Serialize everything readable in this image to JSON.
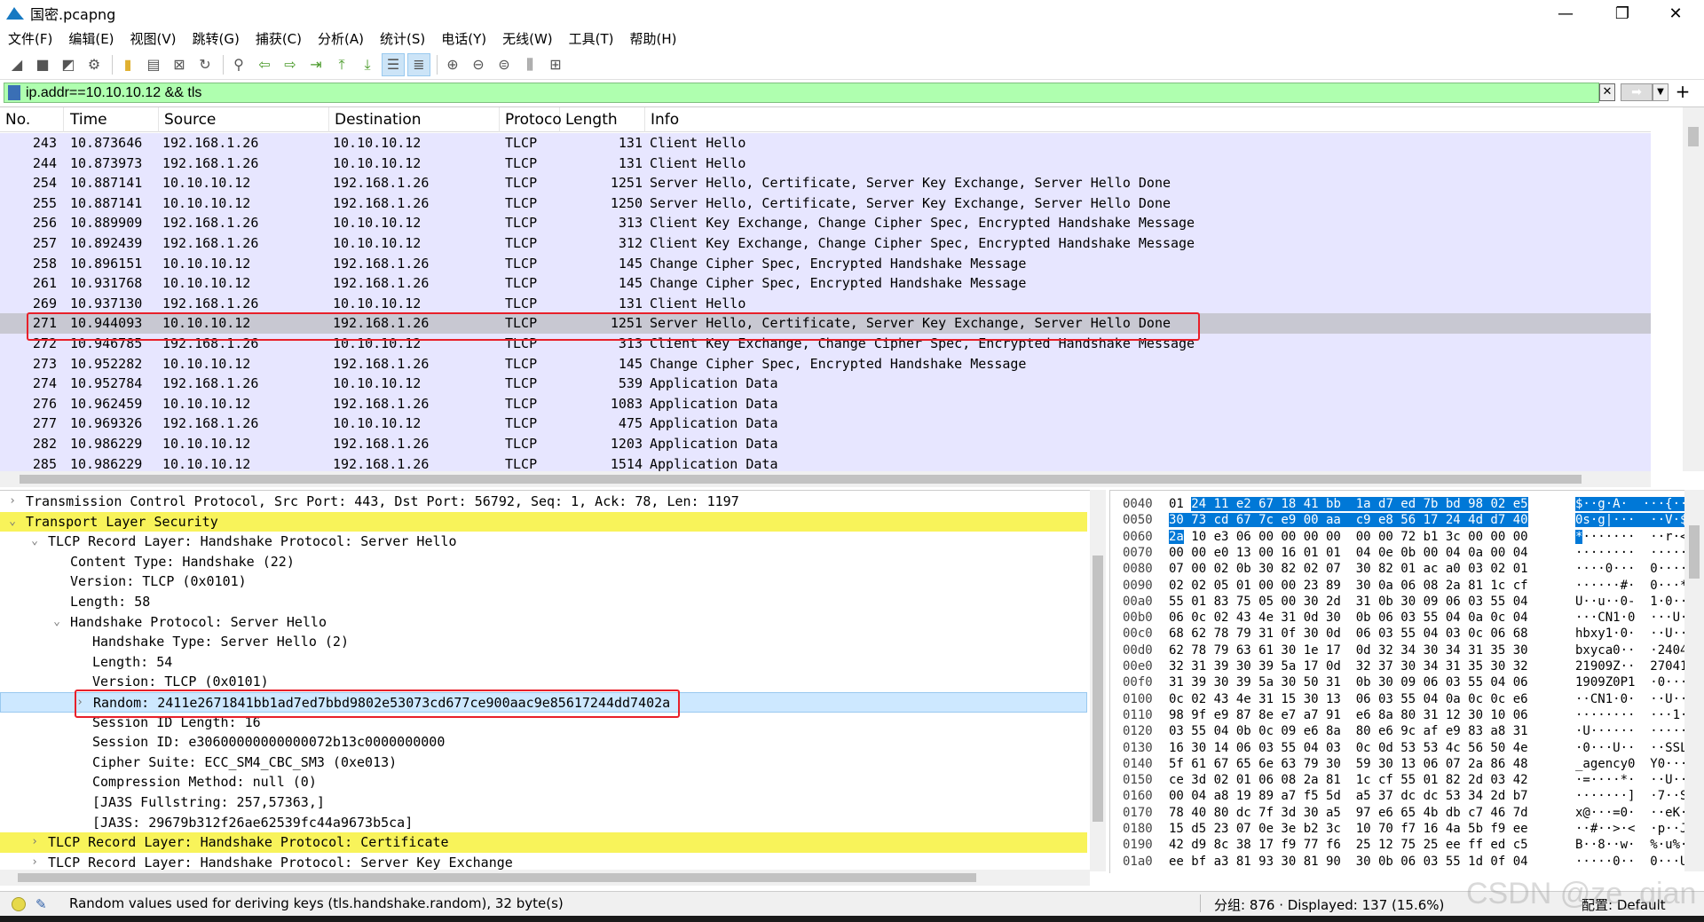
{
  "window": {
    "title": "国密.pcapng",
    "minimize": "—",
    "maximize": "❐",
    "close": "✕"
  },
  "menu": [
    "文件(F)",
    "编辑(E)",
    "视图(V)",
    "跳转(G)",
    "捕获(C)",
    "分析(A)",
    "统计(S)",
    "电话(Y)",
    "无线(W)",
    "工具(T)",
    "帮助(H)"
  ],
  "toolbar_icons": [
    "shark-fin-start-icon",
    "stop-icon",
    "restart-icon",
    "options-icon",
    "open-icon",
    "save-icon",
    "close-file-icon",
    "reload-icon",
    "find-icon",
    "go-back-icon",
    "go-forward-icon",
    "go-to-packet-icon",
    "first-packet-icon",
    "last-packet-icon",
    "autoscroll-icon",
    "colorize-icon",
    "zoom-in-icon",
    "zoom-out-icon",
    "normal-size-icon",
    "resize-columns-icon",
    "layout-icon"
  ],
  "filter": {
    "value": "ip.addr==10.10.10.12 && tls",
    "apply_glyph": "➡"
  },
  "columns": [
    "No.",
    "Time",
    "Source",
    "Destination",
    "Protoco",
    "Length",
    "Info"
  ],
  "packets": [
    {
      "no": "243",
      "time": "10.873646",
      "src": "192.168.1.26",
      "dst": "10.10.10.12",
      "proto": "TLCP",
      "len": "131",
      "info": "Client Hello"
    },
    {
      "no": "244",
      "time": "10.873973",
      "src": "192.168.1.26",
      "dst": "10.10.10.12",
      "proto": "TLCP",
      "len": "131",
      "info": "Client Hello"
    },
    {
      "no": "254",
      "time": "10.887141",
      "src": "10.10.10.12",
      "dst": "192.168.1.26",
      "proto": "TLCP",
      "len": "1251",
      "info": "Server Hello, Certificate, Server Key Exchange, Server Hello Done"
    },
    {
      "no": "255",
      "time": "10.887141",
      "src": "10.10.10.12",
      "dst": "192.168.1.26",
      "proto": "TLCP",
      "len": "1250",
      "info": "Server Hello, Certificate, Server Key Exchange, Server Hello Done"
    },
    {
      "no": "256",
      "time": "10.889909",
      "src": "192.168.1.26",
      "dst": "10.10.10.12",
      "proto": "TLCP",
      "len": "313",
      "info": "Client Key Exchange, Change Cipher Spec, Encrypted Handshake Message"
    },
    {
      "no": "257",
      "time": "10.892439",
      "src": "192.168.1.26",
      "dst": "10.10.10.12",
      "proto": "TLCP",
      "len": "312",
      "info": "Client Key Exchange, Change Cipher Spec, Encrypted Handshake Message"
    },
    {
      "no": "258",
      "time": "10.896151",
      "src": "10.10.10.12",
      "dst": "192.168.1.26",
      "proto": "TLCP",
      "len": "145",
      "info": "Change Cipher Spec, Encrypted Handshake Message"
    },
    {
      "no": "261",
      "time": "10.931768",
      "src": "10.10.10.12",
      "dst": "192.168.1.26",
      "proto": "TLCP",
      "len": "145",
      "info": "Change Cipher Spec, Encrypted Handshake Message"
    },
    {
      "no": "269",
      "time": "10.937130",
      "src": "192.168.1.26",
      "dst": "10.10.10.12",
      "proto": "TLCP",
      "len": "131",
      "info": "Client Hello"
    },
    {
      "no": "271",
      "time": "10.944093",
      "src": "10.10.10.12",
      "dst": "192.168.1.26",
      "proto": "TLCP",
      "len": "1251",
      "info": "Server Hello, Certificate, Server Key Exchange, Server Hello Done",
      "selected": true
    },
    {
      "no": "272",
      "time": "10.946785",
      "src": "192.168.1.26",
      "dst": "10.10.10.12",
      "proto": "TLCP",
      "len": "313",
      "info": "Client Key Exchange, Change Cipher Spec, Encrypted Handshake Message"
    },
    {
      "no": "273",
      "time": "10.952282",
      "src": "10.10.10.12",
      "dst": "192.168.1.26",
      "proto": "TLCP",
      "len": "145",
      "info": "Change Cipher Spec, Encrypted Handshake Message"
    },
    {
      "no": "274",
      "time": "10.952784",
      "src": "192.168.1.26",
      "dst": "10.10.10.12",
      "proto": "TLCP",
      "len": "539",
      "info": "Application Data"
    },
    {
      "no": "276",
      "time": "10.962459",
      "src": "10.10.10.12",
      "dst": "192.168.1.26",
      "proto": "TLCP",
      "len": "1083",
      "info": "Application Data"
    },
    {
      "no": "277",
      "time": "10.969326",
      "src": "192.168.1.26",
      "dst": "10.10.10.12",
      "proto": "TLCP",
      "len": "475",
      "info": "Application Data"
    },
    {
      "no": "282",
      "time": "10.986229",
      "src": "10.10.10.12",
      "dst": "192.168.1.26",
      "proto": "TLCP",
      "len": "1203",
      "info": "Application Data"
    },
    {
      "no": "285",
      "time": "10.986229",
      "src": "10.10.10.12",
      "dst": "192.168.1.26",
      "proto": "TLCP",
      "len": "1514",
      "info": "Application Data"
    }
  ],
  "details": [
    {
      "arrow": "›",
      "level": 0,
      "text": "Transmission Control Protocol, Src Port: 443, Dst Port: 56792, Seq: 1, Ack: 78, Len: 1197"
    },
    {
      "arrow": "⌄",
      "level": 0,
      "text": "Transport Layer Security",
      "highlight": true
    },
    {
      "arrow": "⌄",
      "level": 1,
      "text": "TLCP Record Layer: Handshake Protocol: Server Hello"
    },
    {
      "arrow": "",
      "level": 2,
      "text": "Content Type: Handshake (22)"
    },
    {
      "arrow": "",
      "level": 2,
      "text": "Version: TLCP (0x0101)"
    },
    {
      "arrow": "",
      "level": 2,
      "text": "Length: 58"
    },
    {
      "arrow": "⌄",
      "level": 2,
      "text": "Handshake Protocol: Server Hello"
    },
    {
      "arrow": "",
      "level": 3,
      "text": "Handshake Type: Server Hello (2)"
    },
    {
      "arrow": "",
      "level": 3,
      "text": "Length: 54"
    },
    {
      "arrow": "",
      "level": 3,
      "text": "Version: TLCP (0x0101)"
    },
    {
      "arrow": "›",
      "level": 3,
      "text": "Random: 2411e2671841bb1ad7ed7bbd9802e53073cd677ce900aac9e85617244dd7402a",
      "selected": true
    },
    {
      "arrow": "",
      "level": 3,
      "text": "Session ID Length: 16"
    },
    {
      "arrow": "",
      "level": 3,
      "text": "Session ID: e30600000000000072b13c0000000000"
    },
    {
      "arrow": "",
      "level": 3,
      "text": "Cipher Suite: ECC_SM4_CBC_SM3 (0xe013)"
    },
    {
      "arrow": "",
      "level": 3,
      "text": "Compression Method: null (0)"
    },
    {
      "arrow": "",
      "level": 3,
      "text": "[JA3S Fullstring: 257,57363,]"
    },
    {
      "arrow": "",
      "level": 3,
      "text": "[JA3S: 29679b312f26ae62539fc44a9673b5ca]"
    },
    {
      "arrow": "›",
      "level": 1,
      "text": "TLCP Record Layer: Handshake Protocol: Certificate",
      "highlight": true
    },
    {
      "arrow": "›",
      "level": 1,
      "text": "TLCP Record Layer: Handshake Protocol: Server Key Exchange"
    }
  ],
  "hex": [
    {
      "off": "0040",
      "pre": "01 ",
      "sel": "24 11 e2 67 18 41 bb  1a d7 ed 7b bd 98 02 e5",
      "post": "",
      "apre": "",
      "asel": "$··g·A·  ···{····",
      "apost": ""
    },
    {
      "off": "0050",
      "pre": "",
      "sel": "30 73 cd 67 7c e9 00 aa  c9 e8 56 17 24 4d d7 40",
      "post": "",
      "apre": "",
      "asel": "0s·g|···  ··V·$M·@",
      "apost": ""
    },
    {
      "off": "0060",
      "pre": "",
      "sel": "2a",
      "post": " 10 e3 06 00 00 00 00  00 00 72 b1 3c 00 00 00",
      "apre": "",
      "asel": "*",
      "apost": "·······  ··r·<···"
    },
    {
      "off": "0070",
      "pre": "00 00 e0 13 00 16 01 01  04 0e 0b 00 04 0a 00 04",
      "sel": "",
      "post": "",
      "apre": "········  ········",
      "asel": "",
      "apost": ""
    },
    {
      "off": "0080",
      "pre": "07 00 02 0b 30 82 02 07  30 82 01 ac a0 03 02 01",
      "sel": "",
      "post": "",
      "apre": "····0···  0·······",
      "asel": "",
      "apost": ""
    },
    {
      "off": "0090",
      "pre": "02 02 05 01 00 00 23 89  30 0a 06 08 2a 81 1c cf",
      "sel": "",
      "post": "",
      "apre": "······#·  0···*···",
      "asel": "",
      "apost": ""
    },
    {
      "off": "00a0",
      "pre": "55 01 83 75 05 00 30 2d  31 0b 30 09 06 03 55 04",
      "sel": "",
      "post": "",
      "apre": "U··u··0-  1·0···U·",
      "asel": "",
      "apost": ""
    },
    {
      "off": "00b0",
      "pre": "06 0c 02 43 4e 31 0d 30  0b 06 03 55 04 0a 0c 04",
      "sel": "",
      "post": "",
      "apre": "···CN1·0  ···U····",
      "asel": "",
      "apost": ""
    },
    {
      "off": "00c0",
      "pre": "68 62 78 79 31 0f 30 0d  06 03 55 04 03 0c 06 68",
      "sel": "",
      "post": "",
      "apre": "hbxy1·0·  ··U····h",
      "asel": "",
      "apost": ""
    },
    {
      "off": "00d0",
      "pre": "62 78 79 63 61 30 1e 17  0d 32 34 30 34 31 35 30",
      "sel": "",
      "post": "",
      "apre": "bxyca0··  ·2404150",
      "asel": "",
      "apost": ""
    },
    {
      "off": "00e0",
      "pre": "32 31 39 30 39 5a 17 0d  32 37 30 34 31 35 30 32",
      "sel": "",
      "post": "",
      "apre": "21909Z··  27041502",
      "asel": "",
      "apost": ""
    },
    {
      "off": "00f0",
      "pre": "31 39 30 39 5a 30 50 31  0b 30 09 06 03 55 04 06",
      "sel": "",
      "post": "",
      "apre": "1909Z0P1  ·0···U··",
      "asel": "",
      "apost": ""
    },
    {
      "off": "0100",
      "pre": "0c 02 43 4e 31 15 30 13  06 03 55 04 0a 0c 0c e6",
      "sel": "",
      "post": "",
      "apre": "··CN1·0·  ··U·····",
      "asel": "",
      "apost": ""
    },
    {
      "off": "0110",
      "pre": "98 9f e9 87 8e e7 a7 91  e6 8a 80 31 12 30 10 06",
      "sel": "",
      "post": "",
      "apre": "········  ···1·0··",
      "asel": "",
      "apost": ""
    },
    {
      "off": "0120",
      "pre": "03 55 04 0b 0c 09 e6 8a  80 e6 9c af e9 83 a8 31",
      "sel": "",
      "post": "",
      "apre": "·U······  ·······1",
      "asel": "",
      "apost": ""
    },
    {
      "off": "0130",
      "pre": "16 30 14 06 03 55 04 03  0c 0d 53 53 4c 56 50 4e",
      "sel": "",
      "post": "",
      "apre": "·0···U··  ··SSLVPN",
      "asel": "",
      "apost": ""
    },
    {
      "off": "0140",
      "pre": "5f 61 67 65 6e 63 79 30  59 30 13 06 07 2a 86 48",
      "sel": "",
      "post": "",
      "apre": "_agency0  Y0···*·H",
      "asel": "",
      "apost": ""
    },
    {
      "off": "0150",
      "pre": "ce 3d 02 01 06 08 2a 81  1c cf 55 01 82 2d 03 42",
      "sel": "",
      "post": "",
      "apre": "·=····*·  ··U··-·B",
      "asel": "",
      "apost": ""
    },
    {
      "off": "0160",
      "pre": "00 04 a8 19 89 a7 f5 5d  a5 37 dc dc 53 34 2d b7",
      "sel": "",
      "post": "",
      "apre": "·······]  ·7··S4-·",
      "asel": "",
      "apost": ""
    },
    {
      "off": "0170",
      "pre": "78 40 80 dc 7f 3d 30 a5  97 e6 65 4b db c7 46 7d",
      "sel": "",
      "post": "",
      "apre": "x@···=0·  ··eK··F}",
      "asel": "",
      "apost": ""
    },
    {
      "off": "0180",
      "pre": "15 d5 23 07 0e 3e b2 3c  10 70 f7 16 4a 5b f9 ee",
      "sel": "",
      "post": "",
      "apre": "··#··>·<  ·p··J[··",
      "asel": "",
      "apost": ""
    },
    {
      "off": "0190",
      "pre": "42 d9 8c 38 17 f9 77 f6  25 12 75 25 ee ff ed c5",
      "sel": "",
      "post": "",
      "apre": "B··8··w·  %·u%····",
      "asel": "",
      "apost": ""
    },
    {
      "off": "01a0",
      "pre": "ee bf a3 81 93 30 81 90  30 0b 06 03 55 1d 0f 04",
      "sel": "",
      "post": "",
      "apre": "·····0··  0···U···",
      "asel": "",
      "apost": ""
    }
  ],
  "status": {
    "message": "Random values used for deriving keys (tls.handshake.random), 32 byte(s)",
    "stats": "分组: 876 · Displayed: 137 (15.6%)",
    "profile": "配置: Default",
    "edit_glyph": "✎"
  },
  "watermark": "CSDN @ze_qian",
  "colors": {
    "row_bg": "#e7e6ff",
    "selected_row_bg": "#c8c8d2",
    "filter_ok": "#afffaf",
    "highlight_yellow": "#f8f35a",
    "annotation_red": "#e8202a",
    "hex_select": "#0078d7"
  }
}
